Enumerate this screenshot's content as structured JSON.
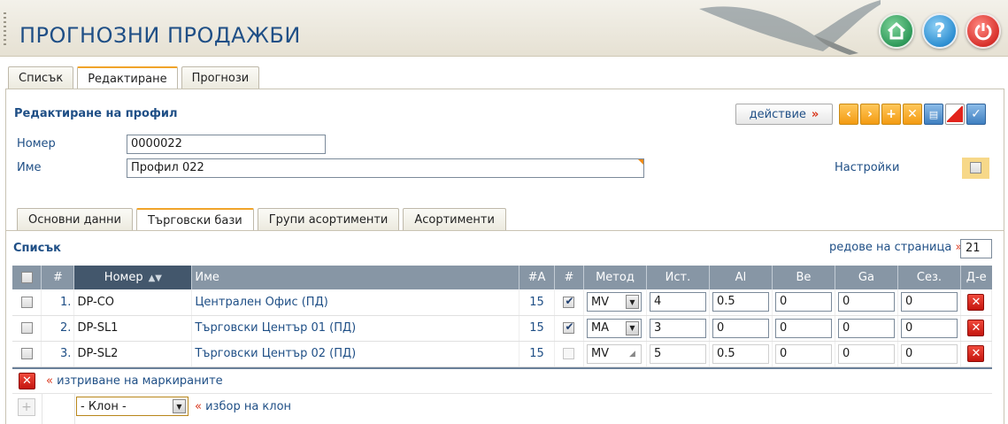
{
  "header": {
    "title": "ПРОГНОЗНИ ПРОДАЖБИ",
    "home_icon": "home-icon",
    "help_icon": "help-icon",
    "power_icon": "power-icon"
  },
  "main_tabs": [
    {
      "label": "Списък",
      "active": false
    },
    {
      "label": "Редактиране",
      "active": true
    },
    {
      "label": "Прогнози",
      "active": false
    }
  ],
  "form": {
    "section_title": "Редактиране на профил",
    "action_label": "действие",
    "number_label": "Номер",
    "number_value": "0000022",
    "name_label": "Име",
    "name_value": "Профил 022",
    "settings_label": "Настройки"
  },
  "toolbar": {
    "icons": [
      "prev-icon",
      "next-icon",
      "add-icon",
      "cancel-icon",
      "print-icon",
      "delete-icon",
      "save-icon"
    ]
  },
  "sub_tabs": [
    {
      "label": "Основни данни",
      "active": false
    },
    {
      "label": "Търговски бази",
      "active": true
    },
    {
      "label": "Групи асортименти",
      "active": false
    },
    {
      "label": "Асортименти",
      "active": false
    }
  ],
  "list": {
    "title": "Списък",
    "rows_per_page_label": "редове на страница",
    "rows_per_page": "21",
    "columns": [
      "#",
      "Номер",
      "Име",
      "#A",
      "#",
      "Метод",
      "Ист.",
      "Al",
      "Be",
      "Ga",
      "Сез.",
      "Д-е"
    ],
    "rows": [
      {
        "index": "1.",
        "number": "DP-CO",
        "name": "Централен Офис (ПД)",
        "count": "15",
        "checked": true,
        "method": "MV",
        "hist": "4",
        "al": "0.5",
        "be": "0",
        "ga": "0",
        "season": "0"
      },
      {
        "index": "2.",
        "number": "DP-SL1",
        "name": "Търговски Център 01 (ПД)",
        "count": "15",
        "checked": true,
        "method": "MA",
        "hist": "3",
        "al": "0",
        "be": "0",
        "ga": "0",
        "season": "0"
      },
      {
        "index": "3.",
        "number": "DP-SL2",
        "name": "Търговски Център 02 (ПД)",
        "count": "15",
        "checked": false,
        "method": "MV",
        "hist": "5",
        "al": "0.5",
        "be": "0",
        "ga": "0",
        "season": "0"
      }
    ],
    "delete_marked_label": "изтриване на маркираните",
    "branch_select": "- Клон -",
    "branch_label": "избор на клон"
  }
}
